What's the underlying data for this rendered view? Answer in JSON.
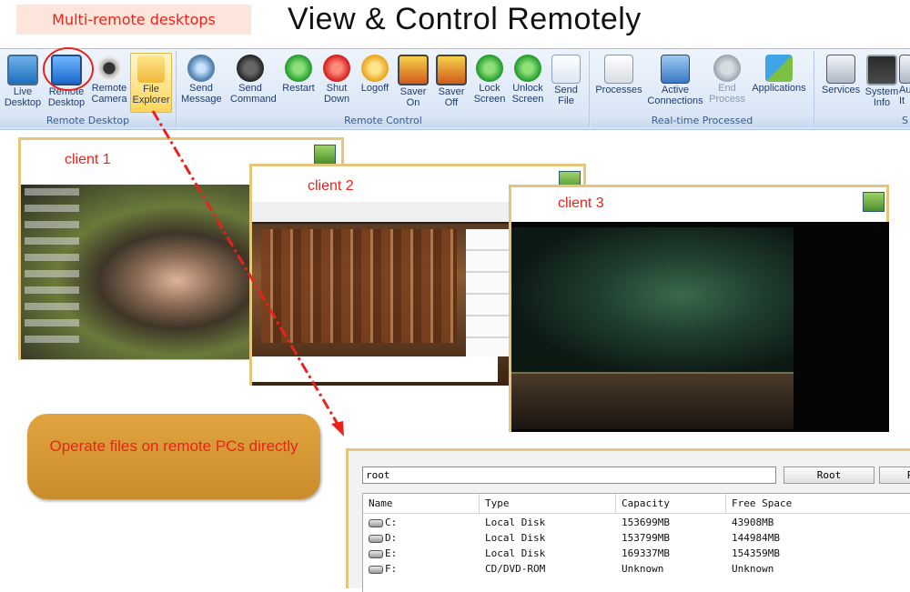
{
  "header": {
    "callout": "Multi-remote desktops",
    "title": "View & Control Remotely"
  },
  "ribbon": {
    "groups": [
      {
        "label": "Remote Desktop",
        "buttons": [
          {
            "label": "Live\nDesktop",
            "icon": "monitor-icon"
          },
          {
            "label": "Remote\nDesktop",
            "icon": "remote-desktop-icon"
          },
          {
            "label": "Remote\nCamera",
            "icon": "webcam-icon"
          },
          {
            "label": "File\nExplorer",
            "icon": "folder-search-icon"
          }
        ]
      },
      {
        "label": "Remote Control",
        "buttons": [
          {
            "label": "Send\nMessage",
            "icon": "globe-icon"
          },
          {
            "label": "Send\nCommand",
            "icon": "command-icon"
          },
          {
            "label": "Restart",
            "icon": "restart-icon"
          },
          {
            "label": "Shut\nDown",
            "icon": "power-icon"
          },
          {
            "label": "Logoff",
            "icon": "key-icon"
          },
          {
            "label": "Saver\nOn",
            "icon": "screensaver-on-icon"
          },
          {
            "label": "Saver\nOff",
            "icon": "screensaver-off-icon"
          },
          {
            "label": "Lock\nScreen",
            "icon": "lock-screen-icon"
          },
          {
            "label": "Unlock\nScreen",
            "icon": "unlock-screen-icon"
          },
          {
            "label": "Send\nFile",
            "icon": "send-file-icon"
          }
        ]
      },
      {
        "label": "Real-time Processed",
        "buttons": [
          {
            "label": "Processes",
            "icon": "processes-icon"
          },
          {
            "label": "Active\nConnections",
            "icon": "connections-icon"
          },
          {
            "label": "End\nProcess",
            "icon": "end-process-icon"
          },
          {
            "label": "Applications",
            "icon": "applications-icon"
          }
        ]
      },
      {
        "label": "S",
        "buttons": [
          {
            "label": "Services",
            "icon": "services-icon"
          },
          {
            "label": "System\nInfo",
            "icon": "system-info-icon"
          },
          {
            "label": "Au\nIt",
            "icon": "autorun-icon"
          }
        ]
      }
    ]
  },
  "clients": [
    {
      "label": "client 1"
    },
    {
      "label": "client 2"
    },
    {
      "label": "client 3"
    }
  ],
  "notice": "Operate files on remote PCs directly",
  "explorer": {
    "path": "root",
    "root_button": "Root",
    "next_button": "R",
    "columns": [
      "Name",
      "Type",
      "Capacity",
      "Free Space"
    ],
    "rows": [
      {
        "name": "C:",
        "type": "Local Disk",
        "capacity": "153699MB",
        "free": "43908MB"
      },
      {
        "name": "D:",
        "type": "Local Disk",
        "capacity": "153799MB",
        "free": "144984MB"
      },
      {
        "name": "E:",
        "type": "Local Disk",
        "capacity": "169337MB",
        "free": "154359MB"
      },
      {
        "name": "F:",
        "type": "CD/DVD-ROM",
        "capacity": "Unknown",
        "free": "Unknown"
      }
    ]
  },
  "colors": {
    "accent_red": "#e8231b",
    "window_border": "#e3c57c",
    "ribbon_text": "#1f3b6b"
  }
}
